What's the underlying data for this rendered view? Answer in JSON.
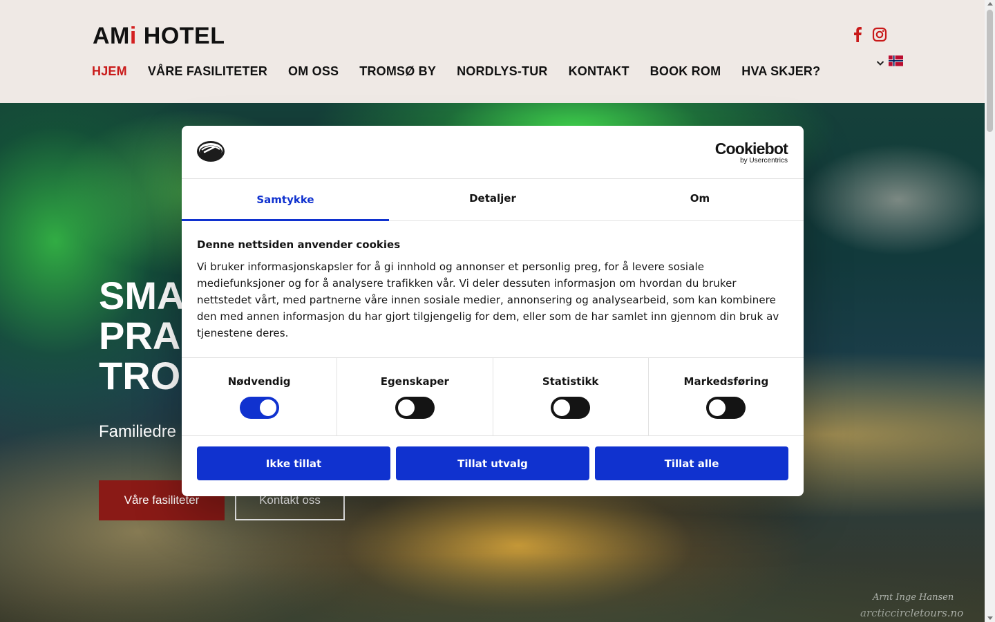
{
  "brand": {
    "logo_prefix": "AM",
    "logo_i": "i",
    "logo_suffix": " HOTEL"
  },
  "header": {
    "nav": [
      {
        "label": "HJEM",
        "active": true
      },
      {
        "label": "VÅRE FASILITETER"
      },
      {
        "label": "OM OSS"
      },
      {
        "label": "TROMSØ BY"
      },
      {
        "label": "NORDLYS-TUR"
      },
      {
        "label": "KONTAKT"
      },
      {
        "label": "BOOK ROM"
      },
      {
        "label": "HVA SKJER?"
      }
    ],
    "social": [
      "facebook-icon",
      "instagram-icon"
    ],
    "language": {
      "icon": "norwegian-flag-icon",
      "dropdown": "chevron-down-icon"
    },
    "accent_color": "#c91a1a"
  },
  "hero": {
    "title_lines": [
      "SMA",
      "PRAK",
      "TRO"
    ],
    "subtitle": "Familiedre",
    "primary_button": "Våre fasiliteter",
    "secondary_button": "Kontakt oss",
    "watermark_signature": "Arnt Inge Hansen",
    "watermark_site": "arcticcircletours.no",
    "primary_color": "#8a1a16"
  },
  "cookie_dialog": {
    "brand_name": "Cookiebot",
    "brand_sub": "by Usercentrics",
    "tabs": [
      {
        "label": "Samtykke",
        "active": true
      },
      {
        "label": "Detaljer"
      },
      {
        "label": "Om"
      }
    ],
    "heading": "Denne nettsiden anvender cookies",
    "body": "Vi bruker informasjonskapsler for å gi innhold og annonser et personlig preg, for å levere sosiale mediefunksjoner og for å analysere trafikken vår. Vi deler dessuten informasjon om hvordan du bruker nettstedet vårt, med partnerne våre innen sosiale medier, annonsering og analysearbeid, som kan kombinere den med annen informasjon du har gjort tilgjengelig for dem, eller som de har samlet inn gjennom din bruk av tjenestene deres.",
    "categories": [
      {
        "label": "Nødvendig",
        "on": true
      },
      {
        "label": "Egenskaper",
        "on": false
      },
      {
        "label": "Statistikk",
        "on": false
      },
      {
        "label": "Markedsføring",
        "on": false
      }
    ],
    "buttons": {
      "deny": "Ikke tillat",
      "selection": "Tillat utvalg",
      "allow_all": "Tillat alle"
    },
    "accent_color": "#1032cf"
  }
}
